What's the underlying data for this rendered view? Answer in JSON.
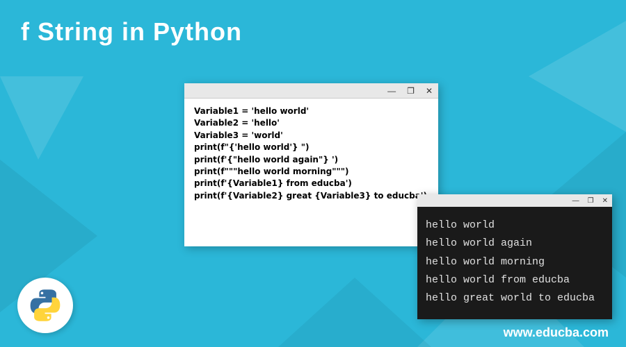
{
  "title": "f String in Python",
  "window_controls": {
    "minimize": "—",
    "maximize": "❐",
    "close": "✕"
  },
  "code_lines": {
    "l0": "Variable1 = 'hello world'",
    "l1": "Variable2 = 'hello'",
    "l2": "Variable3 = 'world'",
    "l3": "print(f\"{'hello world'} \")",
    "l4": "print(f'{\"hello world again\"} ')",
    "l5": "print(f\"\"\"hello world morning\"\"\")",
    "l6": "print(f'{Variable1} from educba')",
    "l7": "print(f'{Variable2} great {Variable3} to educba')"
  },
  "output_lines": {
    "o0": "hello world",
    "o1": "hello world again",
    "o2": "hello world morning",
    "o3": "hello world from educba",
    "o4": "hello great world to educba"
  },
  "footer": "www.educba.com"
}
